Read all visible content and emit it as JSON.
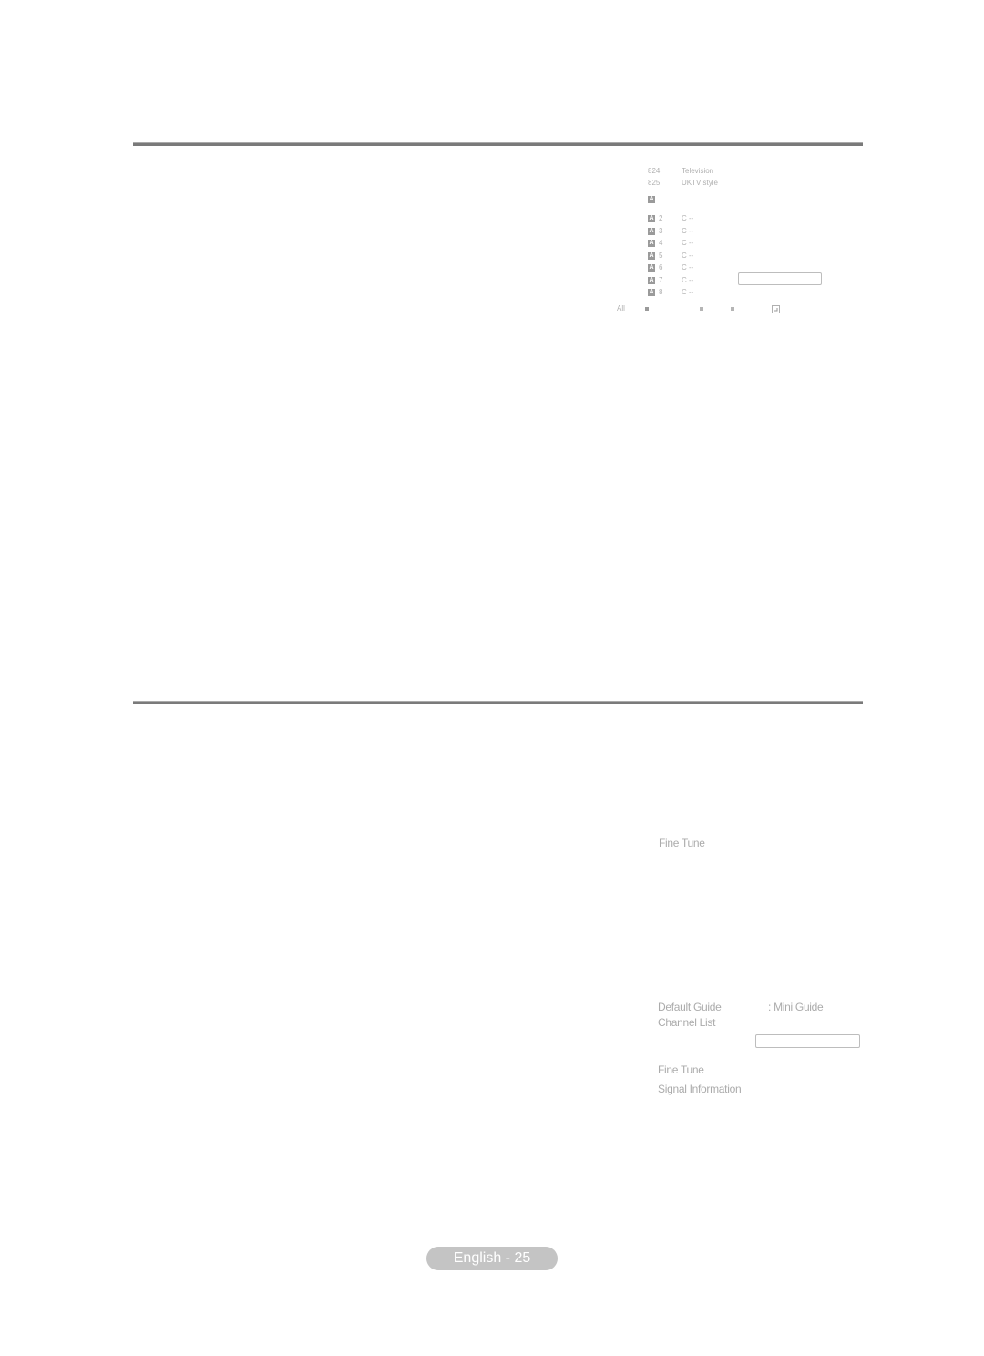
{
  "top_screen": {
    "channels": [
      {
        "number": "824",
        "name": "Television"
      },
      {
        "number": "825",
        "name": "UKTV style"
      }
    ],
    "section_badge": "A",
    "analogue_channels": [
      {
        "badge": "A",
        "number": "2",
        "channel": "C --"
      },
      {
        "badge": "A",
        "number": "3",
        "channel": "C --"
      },
      {
        "badge": "A",
        "number": "4",
        "channel": "C --"
      },
      {
        "badge": "A",
        "number": "5",
        "channel": "C --"
      },
      {
        "badge": "A",
        "number": "6",
        "channel": "C --"
      },
      {
        "badge": "A",
        "number": "7",
        "channel": "C --"
      },
      {
        "badge": "A",
        "number": "8",
        "channel": "C --"
      }
    ],
    "legend": {
      "all_label": "All",
      "icons": [
        "square-icon",
        "square-icon",
        "square-icon",
        "return-icon"
      ]
    }
  },
  "bottom_screen": {
    "fine_tune_1": "Fine Tune",
    "default_guide_label": "Default Guide",
    "default_guide_value": ": Mini Guide",
    "channel_list": "Channel List",
    "fine_tune_2": "Fine Tune",
    "signal_information": "Signal Information"
  },
  "footer": {
    "page_label": "English - 25"
  },
  "colors": {
    "rule": "#7a7a7a",
    "text": "#b0b0b0",
    "badge": "#9a9a9a",
    "pill": "#c4c4c4"
  }
}
